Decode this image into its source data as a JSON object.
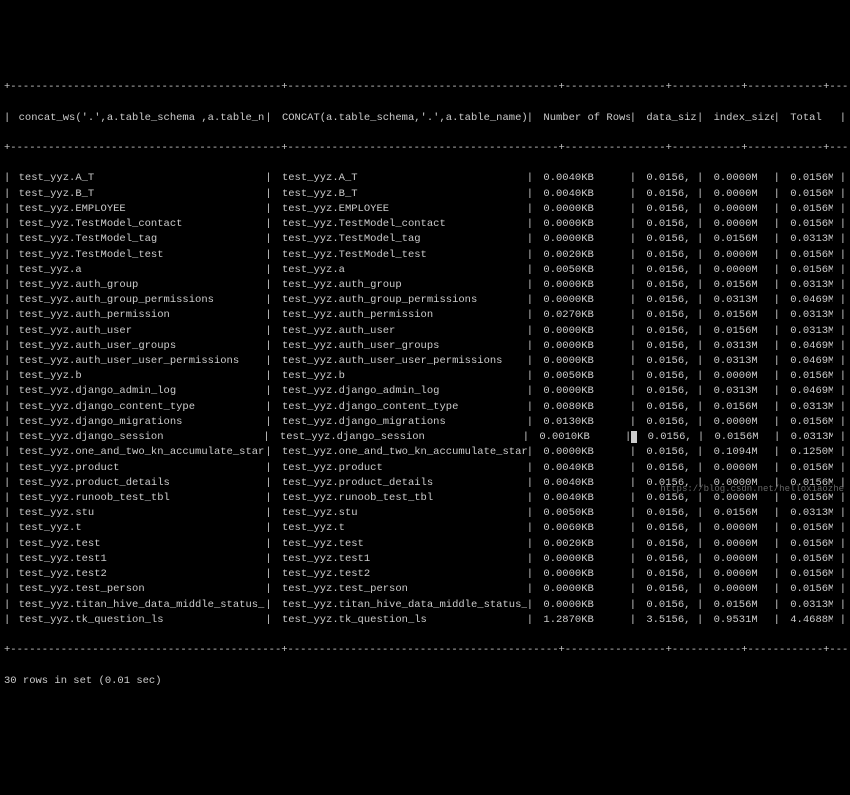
{
  "headers": {
    "col0": "concat_ws('.',a.table_schema ,a.table_name)",
    "col1": "CONCAT(a.table_schema,'.',a.table_name)",
    "col2": "Number of Rows",
    "col3": "data_size",
    "col4": "index_size",
    "col5": "Total"
  },
  "sep_line": "+-------------------------------------------+-------------------------------------------+----------------+-----------+------------+---------+",
  "rows": [
    {
      "c0": "test_yyz.A_T",
      "c1": "test_yyz.A_T",
      "c2": "0.0040KB",
      "c3": "0.0156,",
      "c4": "0.0000M",
      "c5": "0.0156M"
    },
    {
      "c0": "test_yyz.B_T",
      "c1": "test_yyz.B_T",
      "c2": "0.0040KB",
      "c3": "0.0156,",
      "c4": "0.0000M",
      "c5": "0.0156M"
    },
    {
      "c0": "test_yyz.EMPLOYEE",
      "c1": "test_yyz.EMPLOYEE",
      "c2": "0.0000KB",
      "c3": "0.0156,",
      "c4": "0.0000M",
      "c5": "0.0156M"
    },
    {
      "c0": "test_yyz.TestModel_contact",
      "c1": "test_yyz.TestModel_contact",
      "c2": "0.0000KB",
      "c3": "0.0156,",
      "c4": "0.0000M",
      "c5": "0.0156M"
    },
    {
      "c0": "test_yyz.TestModel_tag",
      "c1": "test_yyz.TestModel_tag",
      "c2": "0.0000KB",
      "c3": "0.0156,",
      "c4": "0.0156M",
      "c5": "0.0313M"
    },
    {
      "c0": "test_yyz.TestModel_test",
      "c1": "test_yyz.TestModel_test",
      "c2": "0.0020KB",
      "c3": "0.0156,",
      "c4": "0.0000M",
      "c5": "0.0156M"
    },
    {
      "c0": "test_yyz.a",
      "c1": "test_yyz.a",
      "c2": "0.0050KB",
      "c3": "0.0156,",
      "c4": "0.0000M",
      "c5": "0.0156M"
    },
    {
      "c0": "test_yyz.auth_group",
      "c1": "test_yyz.auth_group",
      "c2": "0.0000KB",
      "c3": "0.0156,",
      "c4": "0.0156M",
      "c5": "0.0313M"
    },
    {
      "c0": "test_yyz.auth_group_permissions",
      "c1": "test_yyz.auth_group_permissions",
      "c2": "0.0000KB",
      "c3": "0.0156,",
      "c4": "0.0313M",
      "c5": "0.0469M"
    },
    {
      "c0": "test_yyz.auth_permission",
      "c1": "test_yyz.auth_permission",
      "c2": "0.0270KB",
      "c3": "0.0156,",
      "c4": "0.0156M",
      "c5": "0.0313M"
    },
    {
      "c0": "test_yyz.auth_user",
      "c1": "test_yyz.auth_user",
      "c2": "0.0000KB",
      "c3": "0.0156,",
      "c4": "0.0156M",
      "c5": "0.0313M"
    },
    {
      "c0": "test_yyz.auth_user_groups",
      "c1": "test_yyz.auth_user_groups",
      "c2": "0.0000KB",
      "c3": "0.0156,",
      "c4": "0.0313M",
      "c5": "0.0469M"
    },
    {
      "c0": "test_yyz.auth_user_user_permissions",
      "c1": "test_yyz.auth_user_user_permissions",
      "c2": "0.0000KB",
      "c3": "0.0156,",
      "c4": "0.0313M",
      "c5": "0.0469M"
    },
    {
      "c0": "test_yyz.b",
      "c1": "test_yyz.b",
      "c2": "0.0050KB",
      "c3": "0.0156,",
      "c4": "0.0000M",
      "c5": "0.0156M"
    },
    {
      "c0": "test_yyz.django_admin_log",
      "c1": "test_yyz.django_admin_log",
      "c2": "0.0000KB",
      "c3": "0.0156,",
      "c4": "0.0313M",
      "c5": "0.0469M"
    },
    {
      "c0": "test_yyz.django_content_type",
      "c1": "test_yyz.django_content_type",
      "c2": "0.0080KB",
      "c3": "0.0156,",
      "c4": "0.0156M",
      "c5": "0.0313M"
    },
    {
      "c0": "test_yyz.django_migrations",
      "c1": "test_yyz.django_migrations",
      "c2": "0.0130KB",
      "c3": "0.0156,",
      "c4": "0.0000M",
      "c5": "0.0156M"
    },
    {
      "c0": "test_yyz.django_session",
      "c1": "test_yyz.django_session",
      "c2": "0.0010KB",
      "c3": "0.0156,",
      "c4": "0.0156M",
      "c5": "0.0313M",
      "cursor": true
    },
    {
      "c0": "test_yyz.one_and_two_kn_accumulate_stars",
      "c1": "test_yyz.one_and_two_kn_accumulate_stars",
      "c2": "0.0000KB",
      "c3": "0.0156,",
      "c4": "0.1094M",
      "c5": "0.1250M"
    },
    {
      "c0": "test_yyz.product",
      "c1": "test_yyz.product",
      "c2": "0.0040KB",
      "c3": "0.0156,",
      "c4": "0.0000M",
      "c5": "0.0156M"
    },
    {
      "c0": "test_yyz.product_details",
      "c1": "test_yyz.product_details",
      "c2": "0.0040KB",
      "c3": "0.0156,",
      "c4": "0.0000M",
      "c5": "0.0156M"
    },
    {
      "c0": "test_yyz.runoob_test_tbl",
      "c1": "test_yyz.runoob_test_tbl",
      "c2": "0.0040KB",
      "c3": "0.0156,",
      "c4": "0.0000M",
      "c5": "0.0156M"
    },
    {
      "c0": "test_yyz.stu",
      "c1": "test_yyz.stu",
      "c2": "0.0050KB",
      "c3": "0.0156,",
      "c4": "0.0156M",
      "c5": "0.0313M"
    },
    {
      "c0": "test_yyz.t",
      "c1": "test_yyz.t",
      "c2": "0.0060KB",
      "c3": "0.0156,",
      "c4": "0.0000M",
      "c5": "0.0156M"
    },
    {
      "c0": "test_yyz.test",
      "c1": "test_yyz.test",
      "c2": "0.0020KB",
      "c3": "0.0156,",
      "c4": "0.0000M",
      "c5": "0.0156M"
    },
    {
      "c0": "test_yyz.test1",
      "c1": "test_yyz.test1",
      "c2": "0.0000KB",
      "c3": "0.0156,",
      "c4": "0.0000M",
      "c5": "0.0156M"
    },
    {
      "c0": "test_yyz.test2",
      "c1": "test_yyz.test2",
      "c2": "0.0000KB",
      "c3": "0.0156,",
      "c4": "0.0000M",
      "c5": "0.0156M"
    },
    {
      "c0": "test_yyz.test_person",
      "c1": "test_yyz.test_person",
      "c2": "0.0000KB",
      "c3": "0.0156,",
      "c4": "0.0000M",
      "c5": "0.0156M"
    },
    {
      "c0": "test_yyz.titan_hive_data_middle_status_new",
      "c1": "test_yyz.titan_hive_data_middle_status_new",
      "c2": "0.0000KB",
      "c3": "0.0156,",
      "c4": "0.0156M",
      "c5": "0.0313M"
    },
    {
      "c0": "test_yyz.tk_question_ls",
      "c1": "test_yyz.tk_question_ls",
      "c2": "1.2870KB",
      "c3": "3.5156,",
      "c4": "0.9531M",
      "c5": "4.4688M"
    }
  ],
  "footer": "30 rows in set (0.01 sec)",
  "watermark": "https://blog.csdn.net/helloxiaozhe"
}
